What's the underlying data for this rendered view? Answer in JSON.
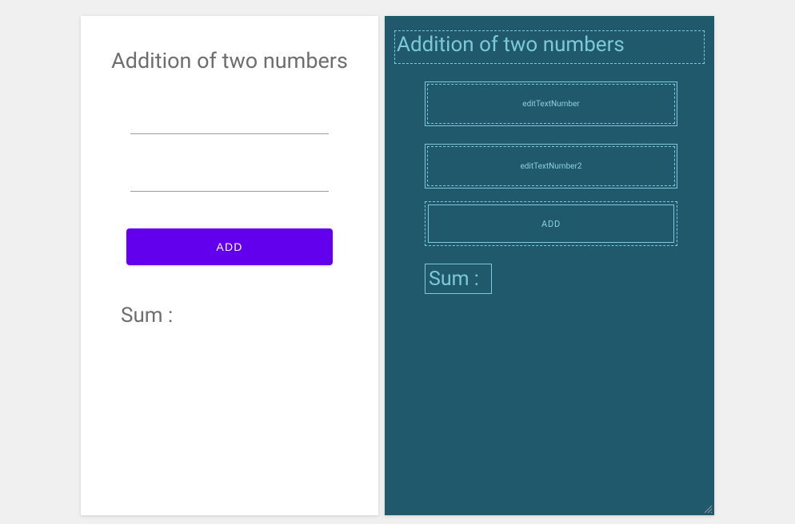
{
  "design": {
    "title": "Addition of two numbers",
    "input1_value": "",
    "input2_value": "",
    "button_label": "ADD",
    "sum_label": "Sum :"
  },
  "blueprint": {
    "title": "Addition of two numbers",
    "field1_id": "editTextNumber",
    "field2_id": "editTextNumber2",
    "button_label": "ADD",
    "sum_label": "Sum :"
  }
}
